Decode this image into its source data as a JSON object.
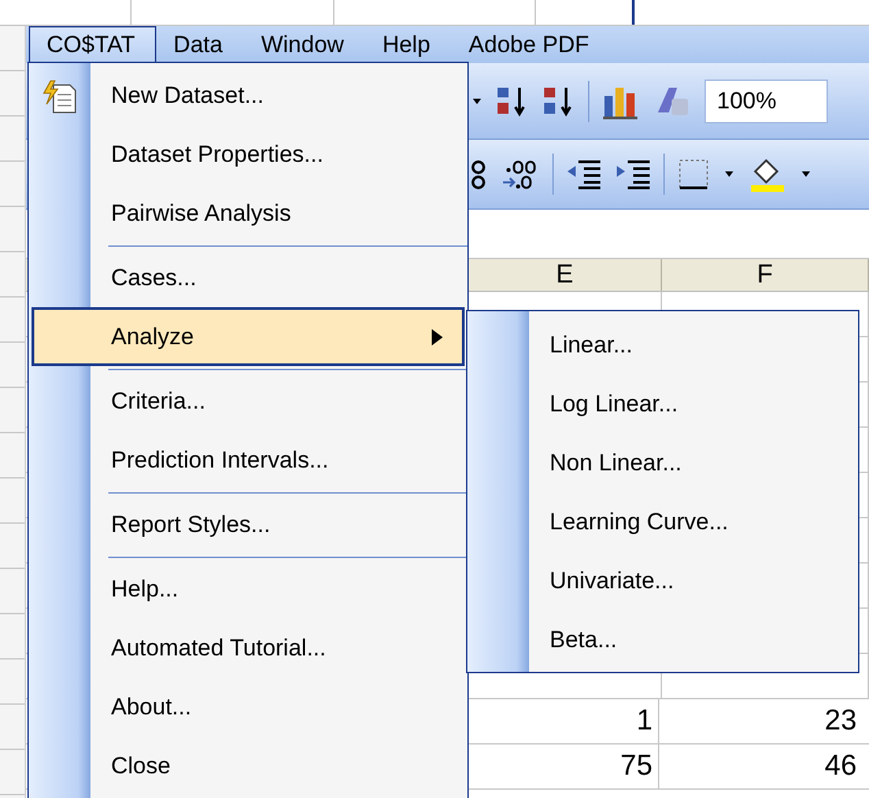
{
  "menubar": {
    "items": [
      {
        "label": "CO$TAT",
        "selected": true
      },
      {
        "label": "Data",
        "selected": false
      },
      {
        "label": "Window",
        "selected": false
      },
      {
        "label": "Help",
        "selected": false
      },
      {
        "label": "Adobe PDF",
        "selected": false
      }
    ]
  },
  "toolbar": {
    "zoom": "100%"
  },
  "sheet": {
    "columns": [
      "E",
      "F"
    ],
    "rows": [
      [
        "1",
        "23"
      ],
      [
        "75",
        "46"
      ]
    ]
  },
  "costat_menu": {
    "items": [
      {
        "kind": "item",
        "label": "New Dataset...",
        "has_icon": true,
        "selected": false
      },
      {
        "kind": "item",
        "label": "Dataset Properties...",
        "selected": false
      },
      {
        "kind": "item",
        "label": "Pairwise Analysis",
        "selected": false
      },
      {
        "kind": "separator"
      },
      {
        "kind": "item",
        "label": "Cases...",
        "selected": false
      },
      {
        "kind": "item",
        "label": "Analyze",
        "has_submenu": true,
        "selected": true
      },
      {
        "kind": "separator"
      },
      {
        "kind": "item",
        "label": "Criteria...",
        "selected": false
      },
      {
        "kind": "item",
        "label": "Prediction Intervals...",
        "selected": false
      },
      {
        "kind": "separator"
      },
      {
        "kind": "item",
        "label": "Report Styles...",
        "selected": false
      },
      {
        "kind": "separator"
      },
      {
        "kind": "item",
        "label": "Help...",
        "selected": false
      },
      {
        "kind": "item",
        "label": "Automated Tutorial...",
        "selected": false
      },
      {
        "kind": "item",
        "label": "About...",
        "selected": false
      },
      {
        "kind": "item",
        "label": "Close",
        "selected": false
      }
    ]
  },
  "analyze_submenu": {
    "items": [
      {
        "label": "Linear...",
        "selected": false
      },
      {
        "label": "Log Linear...",
        "selected": false
      },
      {
        "label": "Non Linear...",
        "selected": false
      },
      {
        "label": "Learning Curve...",
        "selected": false
      },
      {
        "label": "Univariate...",
        "selected": false
      },
      {
        "label": "Beta...",
        "selected": false
      }
    ]
  }
}
